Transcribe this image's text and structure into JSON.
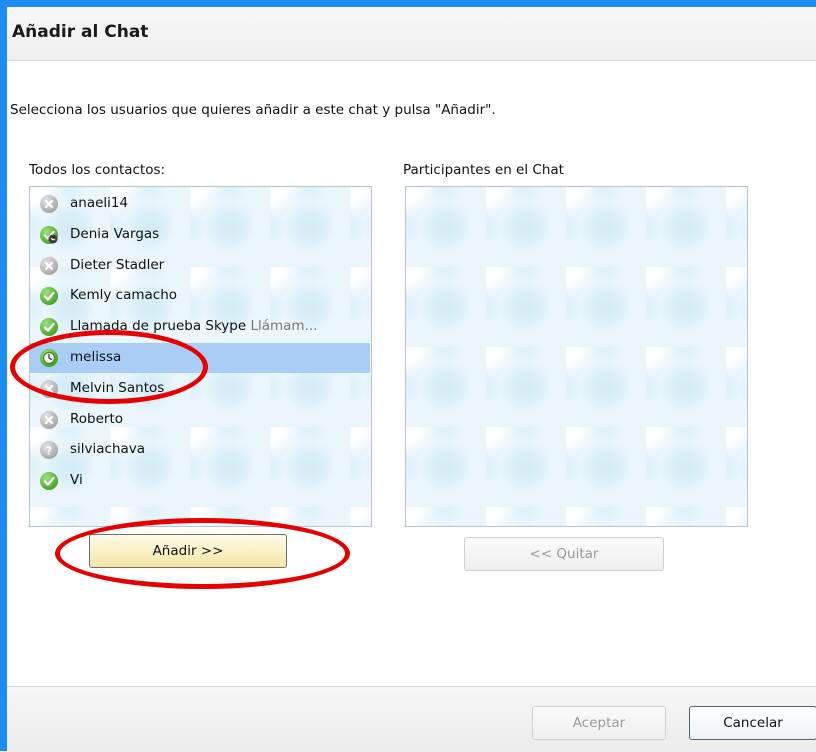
{
  "dialog": {
    "title": "Añadir al Chat",
    "instruction": "Selecciona los usuarios que quieres añadir a este chat y pulsa \"Añadir\"."
  },
  "contacts": {
    "label": "Todos los contactos:",
    "items": [
      {
        "name": "anaeli14",
        "mood": "",
        "status": "offline",
        "selected": false
      },
      {
        "name": "Denia Vargas",
        "mood": "",
        "status": "online-call",
        "selected": false
      },
      {
        "name": "Dieter Stadler",
        "mood": "",
        "status": "offline",
        "selected": false
      },
      {
        "name": "Kemly camacho",
        "mood": "",
        "status": "online",
        "selected": false
      },
      {
        "name": "Llamada de prueba Skype",
        "mood": "Llámam...",
        "status": "online",
        "selected": false
      },
      {
        "name": "melissa",
        "mood": "",
        "status": "away",
        "selected": true
      },
      {
        "name": "Melvin Santos",
        "mood": "",
        "status": "offline",
        "selected": false
      },
      {
        "name": "Roberto",
        "mood": "",
        "status": "offline",
        "selected": false
      },
      {
        "name": "silviachava",
        "mood": "",
        "status": "unknown",
        "selected": false
      },
      {
        "name": "Vi",
        "mood": "",
        "status": "online",
        "selected": false
      }
    ]
  },
  "participants": {
    "label": "Participantes en el Chat",
    "items": []
  },
  "buttons": {
    "add": "Añadir >>",
    "remove": "<< Quitar",
    "accept": "Aceptar",
    "cancel": "Cancelar"
  },
  "annotation_color": "#e60000",
  "colors": {
    "frame": "#1e8cf0",
    "selection": "#a9cdf5",
    "online": "#4aa52c",
    "offline": "#a5a5a5"
  }
}
